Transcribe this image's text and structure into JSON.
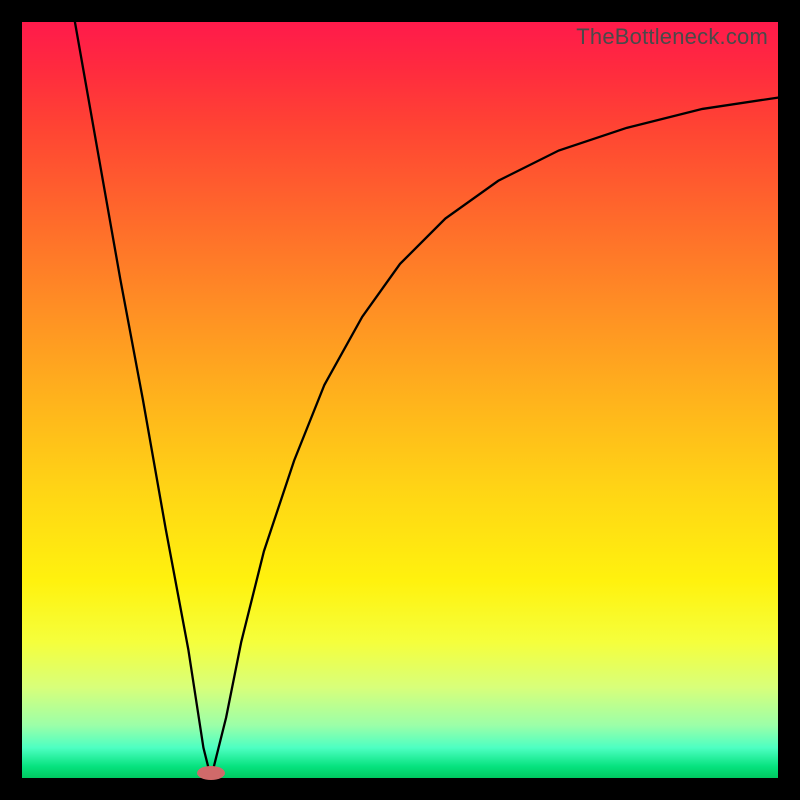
{
  "watermark": "TheBottleneck.com",
  "chart_data": {
    "type": "line",
    "title": "",
    "xlabel": "",
    "ylabel": "",
    "xlim": [
      0,
      100
    ],
    "ylim": [
      0,
      100
    ],
    "annotations": [
      {
        "name": "optimum-marker",
        "x": 25,
        "y": 0
      }
    ],
    "series": [
      {
        "name": "left-branch",
        "x": [
          7,
          10,
          13,
          16,
          19,
          22,
          24,
          25
        ],
        "values": [
          100,
          83,
          66,
          50,
          33,
          17,
          4,
          0
        ]
      },
      {
        "name": "right-branch",
        "x": [
          25,
          27,
          29,
          32,
          36,
          40,
          45,
          50,
          56,
          63,
          71,
          80,
          90,
          100
        ],
        "values": [
          0,
          8,
          18,
          30,
          42,
          52,
          61,
          68,
          74,
          79,
          83,
          86,
          88.5,
          90
        ]
      }
    ]
  },
  "colors": {
    "frame": "#000000",
    "curve": "#000000",
    "marker": "#d06a6a",
    "gradient_top": "#ff1a4b",
    "gradient_bottom": "#00c860"
  }
}
